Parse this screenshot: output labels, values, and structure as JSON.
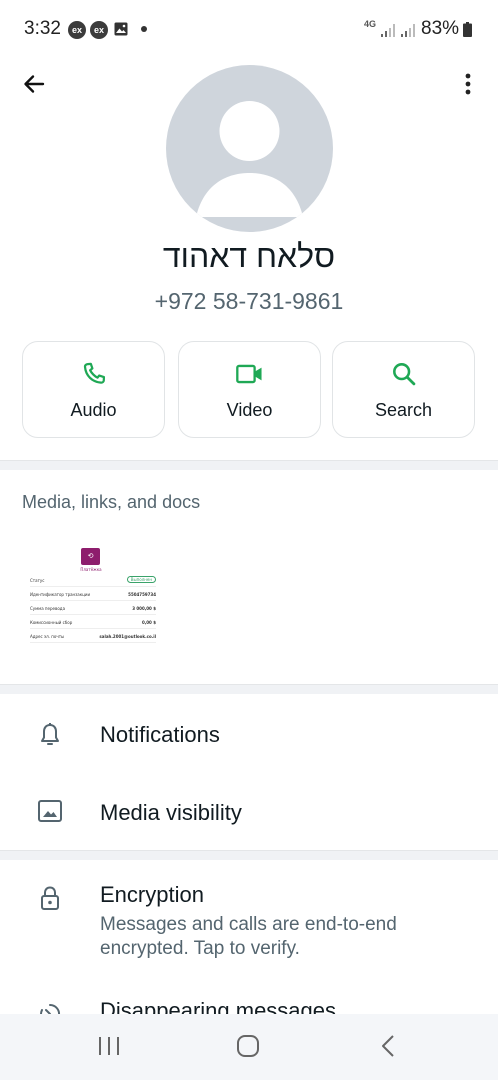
{
  "status_bar": {
    "time": "3:32",
    "badge_1": "ex",
    "badge_2": "ex",
    "network": "4G",
    "battery": "83%"
  },
  "header": {
    "back_icon": "arrow-left-icon",
    "menu_icon": "more-vertical-icon"
  },
  "contact": {
    "name": "סלאח דאהוד",
    "phone": "+972 58-731-9861"
  },
  "actions": [
    {
      "label": "Audio",
      "icon": "phone-icon"
    },
    {
      "label": "Video",
      "icon": "video-icon"
    },
    {
      "label": "Search",
      "icon": "search-icon"
    }
  ],
  "media": {
    "title": "Media, links, and docs",
    "thumb": {
      "brand": "Платёжка",
      "rows": [
        {
          "k": "Статус",
          "v": "Выполнен"
        },
        {
          "k": "Идентификатор транзакции",
          "v": "5504759734"
        },
        {
          "k": "Сумма перевода",
          "v": "3 000,00 $"
        },
        {
          "k": "Комиссионный сбор",
          "v": "0,00 $"
        },
        {
          "k": "Адрес эл. почты",
          "v": "salah.2001@outlook.co.il"
        }
      ]
    }
  },
  "settings": {
    "notifications": "Notifications",
    "media_visibility": "Media visibility",
    "encryption_title": "Encryption",
    "encryption_sub": "Messages and calls are end-to-end encrypted. Tap to verify.",
    "disappearing": "Disappearing messages"
  },
  "colors": {
    "accent": "#1fa855",
    "text_primary": "#111b21",
    "text_secondary": "#54656f",
    "avatar_bg": "#cfd5dc"
  }
}
